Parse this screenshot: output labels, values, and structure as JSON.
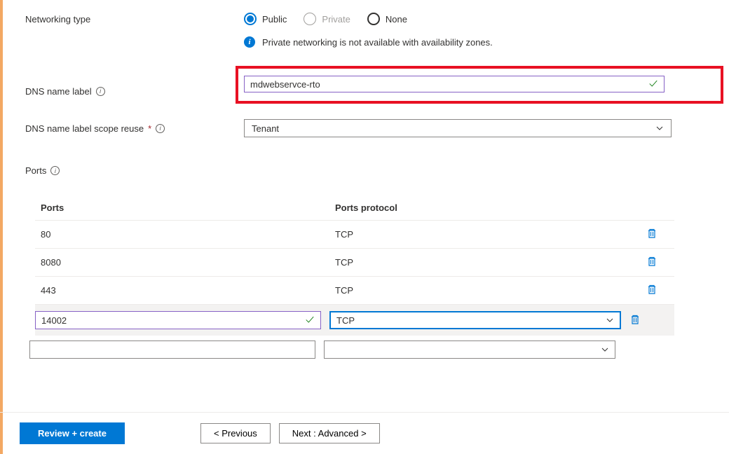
{
  "form": {
    "networking_type_label": "Networking type",
    "networking_options": {
      "public": "Public",
      "private": "Private",
      "none": "None"
    },
    "info_message": "Private networking is not available with availability zones.",
    "dns_name_label": "DNS name label",
    "dns_name_value": "mdwebservce-rto",
    "dns_scope_label": "DNS name label scope reuse",
    "dns_scope_value": "Tenant"
  },
  "ports": {
    "section_label": "Ports",
    "headers": {
      "port": "Ports",
      "protocol": "Ports protocol"
    },
    "rows": [
      {
        "port": "80",
        "protocol": "TCP"
      },
      {
        "port": "8080",
        "protocol": "TCP"
      },
      {
        "port": "443",
        "protocol": "TCP"
      }
    ],
    "editing": {
      "port": "14002",
      "protocol": "TCP"
    }
  },
  "footer": {
    "review": "Review + create",
    "previous": "<  Previous",
    "next": "Next : Advanced  >"
  }
}
